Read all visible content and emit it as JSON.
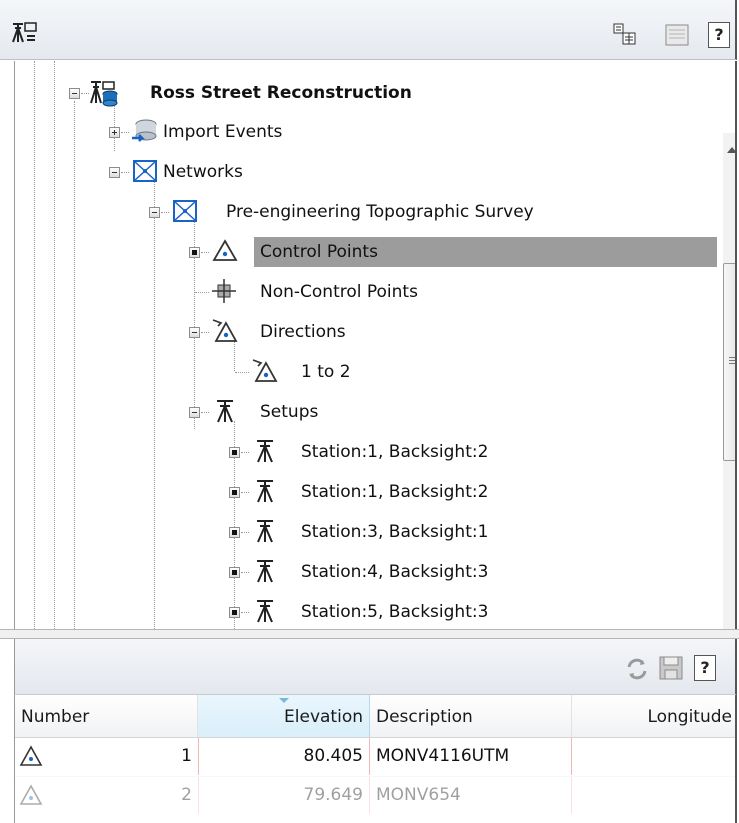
{
  "toolbar": {
    "help_label": "?"
  },
  "tree": {
    "root": {
      "label": "Ross Street Reconstruction"
    },
    "import_events": {
      "label": "Import Events"
    },
    "networks": {
      "label": "Networks"
    },
    "survey": {
      "label": "Pre-engineering Topographic Survey"
    },
    "control_points": {
      "label": "Control Points",
      "selected": true
    },
    "non_control_points": {
      "label": "Non-Control Points"
    },
    "directions": {
      "label": "Directions"
    },
    "direction_1": {
      "label": "1 to 2"
    },
    "setups": {
      "label": "Setups"
    },
    "setup_items": [
      {
        "label": "Station:1, Backsight:2"
      },
      {
        "label": "Station:1, Backsight:2"
      },
      {
        "label": "Station:3, Backsight:1"
      },
      {
        "label": "Station:4, Backsight:3"
      },
      {
        "label": "Station:5, Backsight:3"
      }
    ]
  },
  "bottom_toolbar": {
    "help_label": "?"
  },
  "table": {
    "columns": [
      "Number",
      "Elevation",
      "Description",
      "Longitude"
    ],
    "sorted_column": "Elevation",
    "rows": [
      {
        "number": "1",
        "elevation": "80.405",
        "description": "MONV4116UTM",
        "longitude": ""
      },
      {
        "number": "2",
        "elevation": "79.649",
        "description": "MONV654",
        "longitude": ""
      }
    ]
  },
  "colors": {
    "selection": "#9c9c9c",
    "sorted_header": "#d9effa",
    "border_dark": "#555555"
  }
}
